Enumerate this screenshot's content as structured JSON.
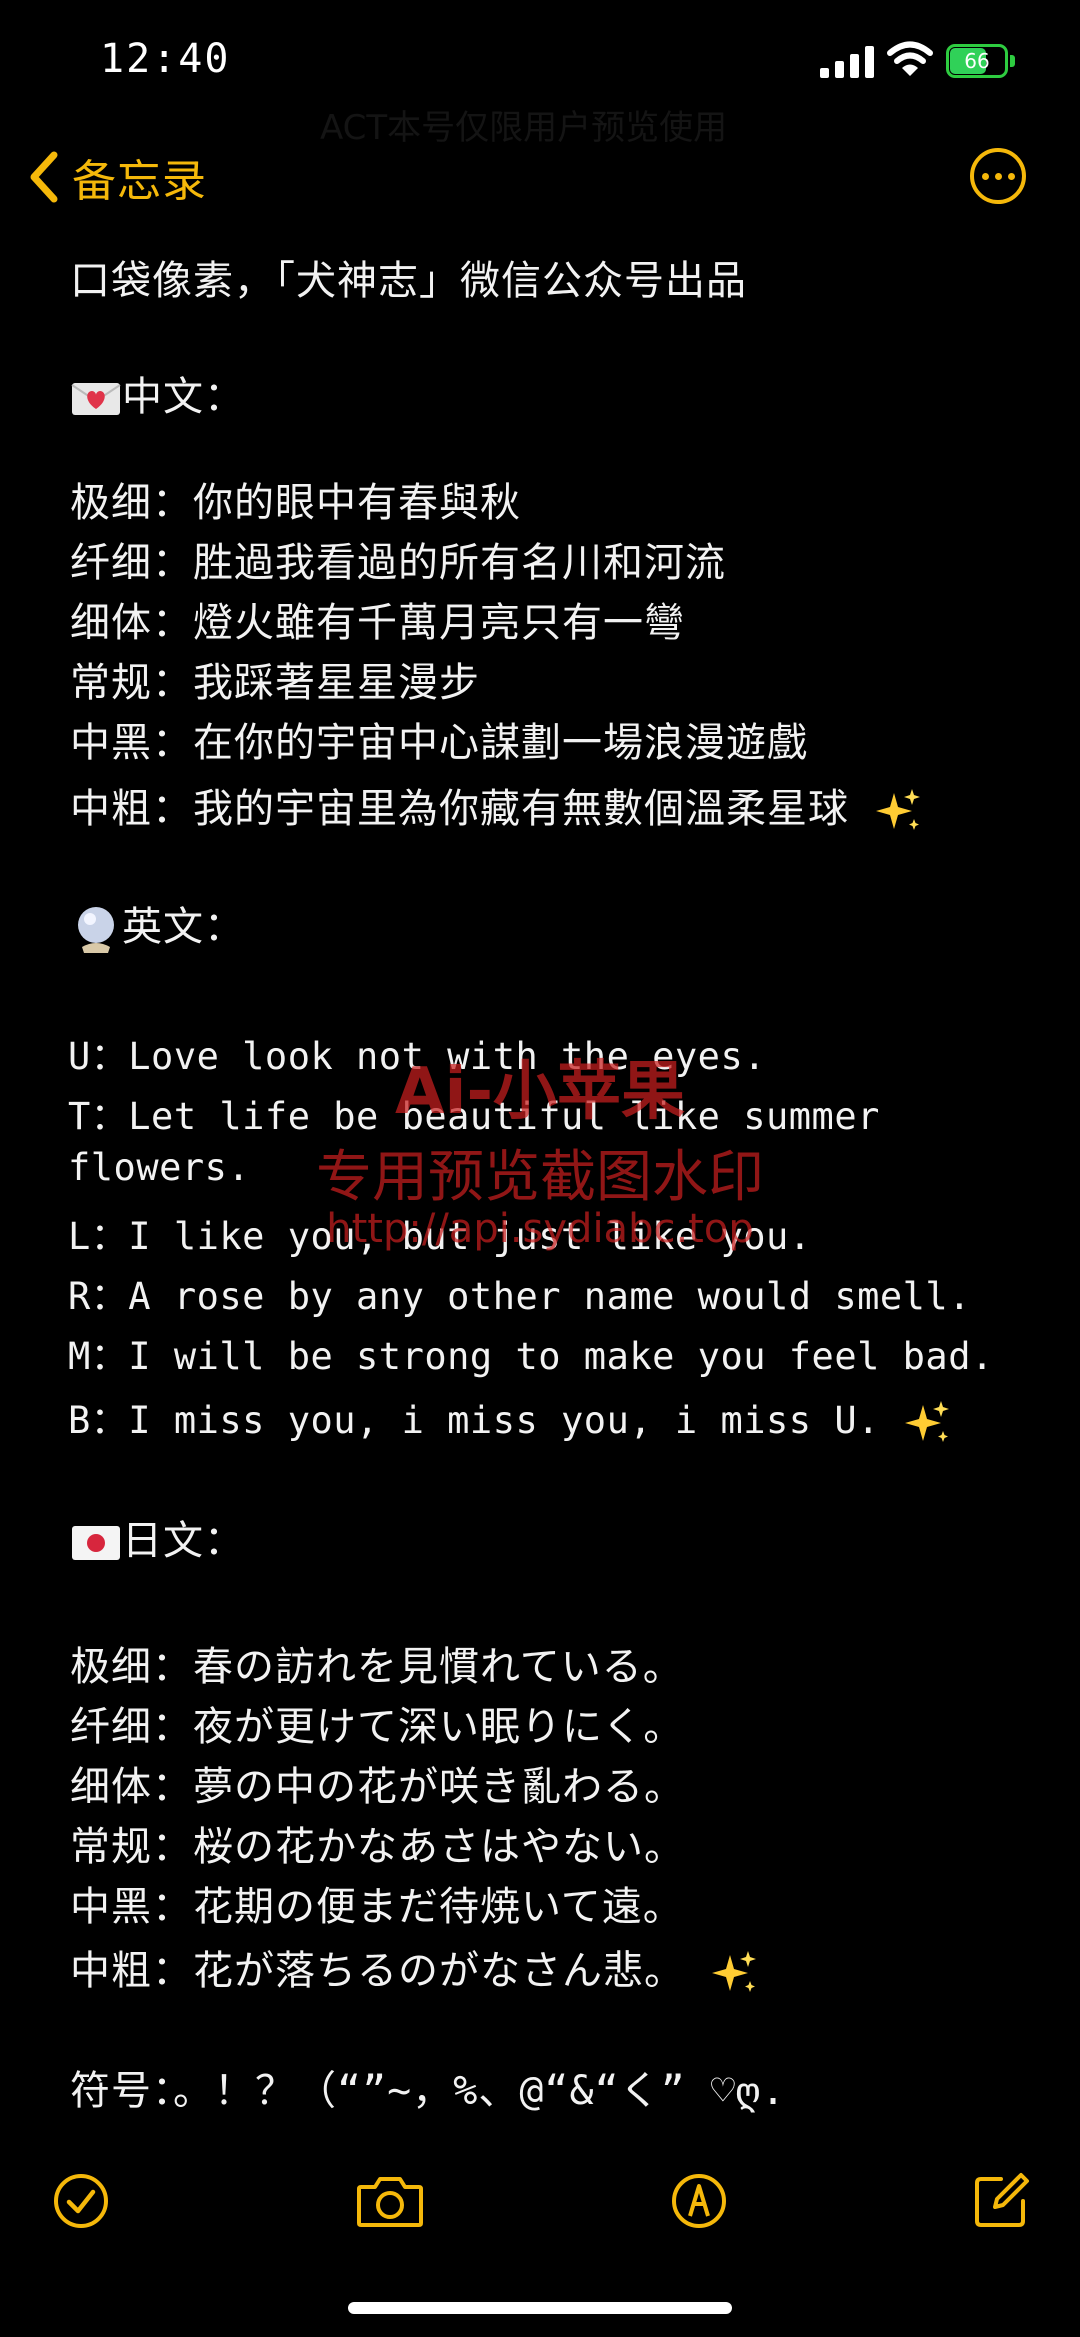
{
  "status_bar": {
    "time": "12:40",
    "battery_level": "66"
  },
  "nav": {
    "back_label": "备忘录"
  },
  "watermark_top": "ACT本号仅限用户预览使用",
  "note": {
    "intro": "口袋像素，「犬神志」微信公众号出品",
    "chinese": {
      "heading": "中文：",
      "lines": [
        "极细：你的眼中有春與秋",
        "纤细：胜過我看過的所有名川和河流",
        "细体：燈火雖有千萬月亮只有一彎",
        "常规：我踩著星星漫步",
        "中黑：在你的宇宙中心謀劃一場浪漫遊戲",
        "中粗：我的宇宙里為你藏有無數個溫柔星球"
      ]
    },
    "english": {
      "heading": "英文：",
      "lines": [
        "U：Love look not with the eyes.",
        "T：Let life be beautiful like summer",
        "flowers.",
        "L：I like you, but just like you.",
        "R：A rose by any other name would smell.",
        "M：I will be strong to make you feel bad.",
        "B：I miss you, i miss you, i miss U."
      ]
    },
    "japanese": {
      "heading": "日文：",
      "lines": [
        "极细：春の訪れを見慣れている。",
        "纤细：夜が更けて深い眠りにく。",
        "细体：夢の中の花が咲き亂わる。",
        "常规：桜の花かなあさはやない。",
        "中黑：花期の便まだ待焼いて遠。",
        "中粗：花が落ちるのがなさん悲。"
      ]
    },
    "symbols": "符号：。！？（“”~，%、@“&“く” ♡ღ."
  },
  "watermark": {
    "line1": "Ai-小苹果",
    "line2": "专用预览截图水印",
    "line3": "http://api.sydiabc.top"
  },
  "colors": {
    "accent": "#f5b80a",
    "battery": "#30d158",
    "watermark": "#c81e1e"
  },
  "icons": [
    "chevron-left-icon",
    "more-icon",
    "checklist-icon",
    "camera-icon",
    "markup-icon",
    "compose-icon",
    "sparkles-icon",
    "love-letter-icon",
    "crystal-ball-icon",
    "japan-flag-icon"
  ]
}
